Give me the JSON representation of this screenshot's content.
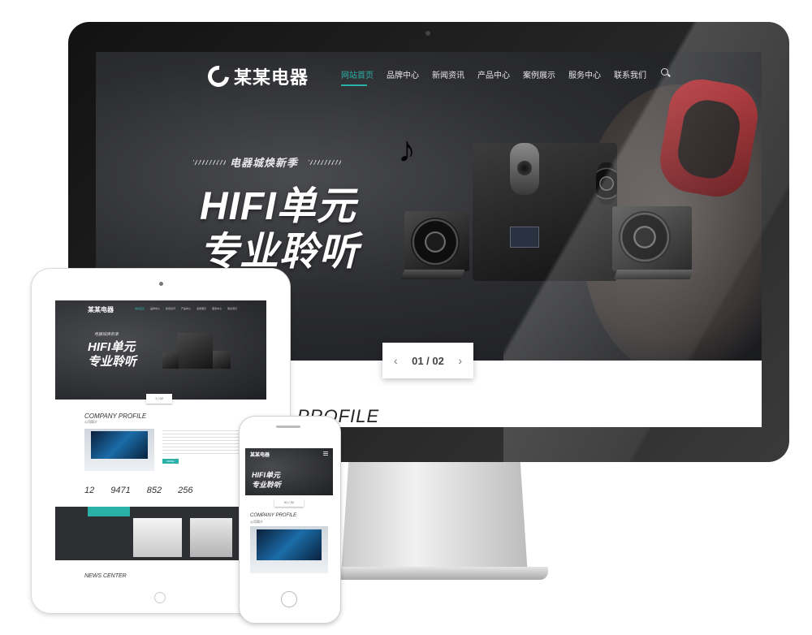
{
  "brand": {
    "name": "某某电器",
    "accent": "#2ab0a7"
  },
  "nav": {
    "items": [
      {
        "label": "网站首页",
        "active": true
      },
      {
        "label": "品牌中心",
        "active": false
      },
      {
        "label": "新闻资讯",
        "active": false
      },
      {
        "label": "产品中心",
        "active": false
      },
      {
        "label": "案例展示",
        "active": false
      },
      {
        "label": "服务中心",
        "active": false
      },
      {
        "label": "联系我们",
        "active": false
      }
    ],
    "search_icon": "search-icon"
  },
  "hero": {
    "tagline": "电器城焕新季",
    "headline_line1": "HIFI单元",
    "headline_line2": "专业聆听",
    "pager": {
      "current": "01",
      "total": "02",
      "text": "01 / 02",
      "prev_icon": "chevron-left-icon",
      "next_icon": "chevron-right-icon"
    }
  },
  "profile": {
    "title": "PROFILE",
    "full_title": "COMPANY PROFILE",
    "subtitle": "公司简介",
    "button": "MORE"
  },
  "stats": [
    {
      "value": "12"
    },
    {
      "value": "9471"
    },
    {
      "value": "852"
    },
    {
      "value": "256"
    }
  ],
  "news": {
    "title": "NEWS CENTER"
  },
  "tablet": {
    "pager_text": "1 / 02"
  },
  "phone": {
    "pager_text": "01 / 02"
  }
}
